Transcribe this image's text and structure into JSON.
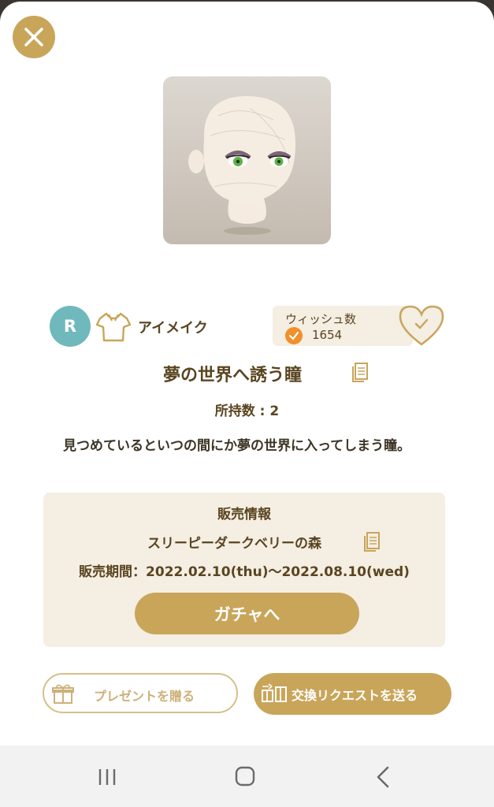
{
  "header": {
    "close_icon": "close-icon"
  },
  "item": {
    "image_desc": "mannequin-head-with-green-eyes",
    "rarity": "R",
    "category_icon": "shirt-icon",
    "category": "アイメイク",
    "title": "夢の世界へ誘う瞳",
    "owned": "所持数 : 2",
    "description": "見つめているといつの間にか夢の世界に入ってしまう瞳。"
  },
  "wish": {
    "label": "ウィッシュ数",
    "count": "1654",
    "icon": "flame-icon",
    "heart_icon": "heart-check-icon"
  },
  "sale": {
    "title": "販売情報",
    "shop": "スリーピーダークベリーの森",
    "period": "販売期間：2022.02.10(thu)〜2022.08.10(wed)",
    "gacha_button": "ガチャへ"
  },
  "actions": {
    "present_label": "プレゼントを贈る",
    "trade_label": "交換リクエストを送る"
  },
  "colors": {
    "accent": "#c9a55a",
    "text": "#5a4520",
    "panel": "#f4eee3",
    "rarity_badge": "#6fb9bd",
    "wish_flame": "#f0902a"
  },
  "navbar": {
    "icons": [
      "recent-apps-icon",
      "home-icon",
      "back-icon"
    ]
  }
}
